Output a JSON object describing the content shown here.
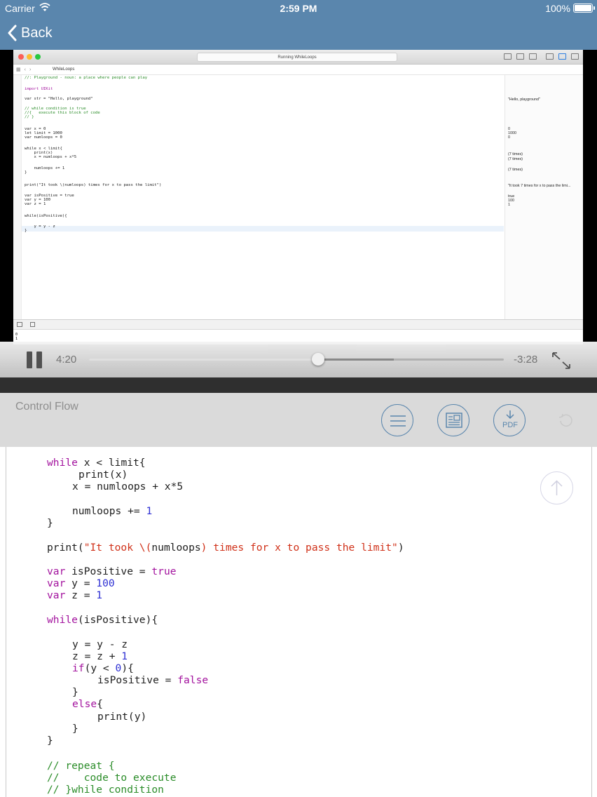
{
  "status_bar": {
    "carrier": "Carrier",
    "time": "2:59 PM",
    "battery": "100%"
  },
  "nav": {
    "back_label": "Back"
  },
  "xcode": {
    "status": "Running WhileLoops",
    "file": "WhileLoops",
    "code_lines": [
      "//: Playground - noun: a place where people can play",
      "import UIKit",
      "var str = \"Hello, playground\"",
      "// while condition is true",
      "//{   execute this block of code",
      "// }",
      "var x = 0",
      "let limit = 1000",
      "var numloops = 0",
      "while x < limit{",
      "    print(x)",
      "    x = numloops + x*5",
      "    numloops += 1",
      "}",
      "print(\"It took \\(numloops) times for x to pass the limit\")",
      "var isPositive = true",
      "var y = 100",
      "var z = 1",
      "while(isPositive){",
      "    y = y - z",
      "}"
    ],
    "results": [
      "\"Hello, playground\"",
      "0",
      "1000",
      "0",
      "(7 times)",
      "(7 times)",
      "(7 times)",
      "\"It took 7 times for x to pass the limi...",
      "true",
      "100",
      "1"
    ],
    "console": [
      "0",
      "1"
    ]
  },
  "player": {
    "elapsed": "4:20",
    "remaining": "-3:28",
    "progress": 0.553,
    "buffered": 0.735
  },
  "lesson": {
    "title": "Control Flow",
    "pdf_label": "PDF"
  },
  "code": {
    "l1_kw": "while",
    "l1_rest": " x < limit{",
    "l2": "print(x)",
    "l3": "x = numloops + x*5",
    "l4_a": "numloops += ",
    "l4_num": "1",
    "l5": "}",
    "l6_a": "print(",
    "l6_s1": "\"It took \\(",
    "l6_b": "numloops",
    "l6_s2": ") times for x to pass the limit\"",
    "l6_c": ")",
    "l7_kw": "var",
    "l7_a": " isPositive = ",
    "l7_val": "true",
    "l8_kw": "var",
    "l8_a": " y = ",
    "l8_num": "100",
    "l9_kw": "var",
    "l9_a": " z = ",
    "l9_num": "1",
    "l10_kw": "while",
    "l10_rest": "(isPositive){",
    "l11": "y = y - z",
    "l12_a": "z = z + ",
    "l12_num": "1",
    "l13_kw": "if",
    "l13_a": "(y < ",
    "l13_num": "0",
    "l13_b": "){",
    "l14_a": "isPositive = ",
    "l14_val": "false",
    "l15": "}",
    "l16_kw": "else",
    "l16_rest": "{",
    "l17": "print(y)",
    "l18": "}",
    "l19": "}",
    "c1": "// repeat {",
    "c2": "//    code to execute",
    "c3": "// }while condition"
  },
  "colors": {
    "nav_bar": "#5a86ad",
    "keyword": "#a3139e",
    "string": "#d03119",
    "number": "#2d2fd3",
    "comment": "#2c8d2a"
  },
  "icons": {
    "wifi": "wifi-icon",
    "back": "chevron-left-icon",
    "pause": "pause-icon",
    "fullscreen": "fullscreen-icon",
    "outline": "list-icon",
    "notes": "document-icon",
    "pdf": "download-pdf-icon",
    "refresh": "refresh-icon",
    "scroll_top": "arrow-up-icon"
  }
}
